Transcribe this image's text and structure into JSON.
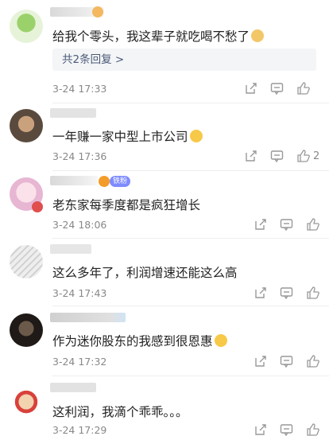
{
  "comments": [
    {
      "text": "给我个零头，我这辈子就吃喝不愁了",
      "emoji": "doge-emoji",
      "replies": "共2条回复 >",
      "time": "3-24 17:33",
      "likes": ""
    },
    {
      "text": "一年赚一家中型上市公司",
      "emoji": "smirk-emoji",
      "time": "3-24 17:36",
      "likes": "2"
    },
    {
      "text": "老东家每季度都是疯狂增长",
      "badge": "铁粉",
      "time": "3-24 18:06",
      "likes": ""
    },
    {
      "text": "这么多年了，利润增速还能这么高",
      "time": "3-24 17:43",
      "likes": ""
    },
    {
      "text": "作为迷你股东的我感到很恩惠",
      "emoji": "smile-emoji",
      "time": "3-24 17:32",
      "likes": ""
    },
    {
      "text": "这利润，我滴个乖乖。。。",
      "time": "3-24 17:29",
      "likes": ""
    }
  ],
  "colors": {
    "link": "#4b5a79",
    "meta": "#888888",
    "badge": "#7f8cff"
  },
  "icons": [
    "share-icon",
    "comment-icon",
    "like-icon"
  ]
}
